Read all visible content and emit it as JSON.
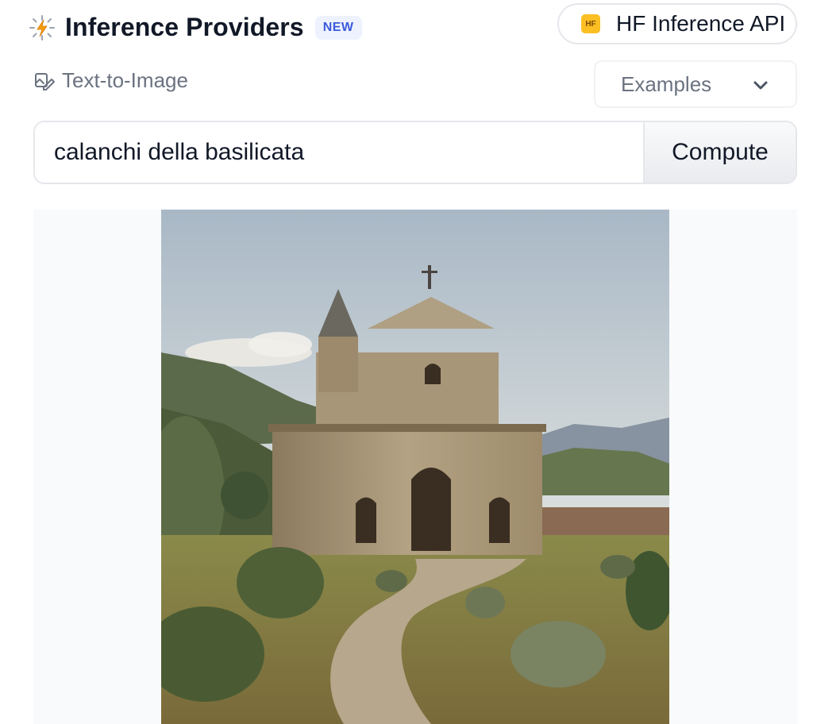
{
  "header": {
    "title": "Inference Providers",
    "badge": "NEW",
    "provider": {
      "logo_text": "HF",
      "label": "HF Inference API"
    }
  },
  "task": {
    "icon": "image-edit-icon",
    "label": "Text-to-Image",
    "examples_label": "Examples"
  },
  "input": {
    "value": "calanchi della basilicata",
    "button_label": "Compute"
  },
  "colors": {
    "badge_bg": "#eef2ff",
    "badge_text": "#3b5bdb",
    "hf_yellow": "#fbbf24",
    "muted_text": "#6b7280"
  }
}
